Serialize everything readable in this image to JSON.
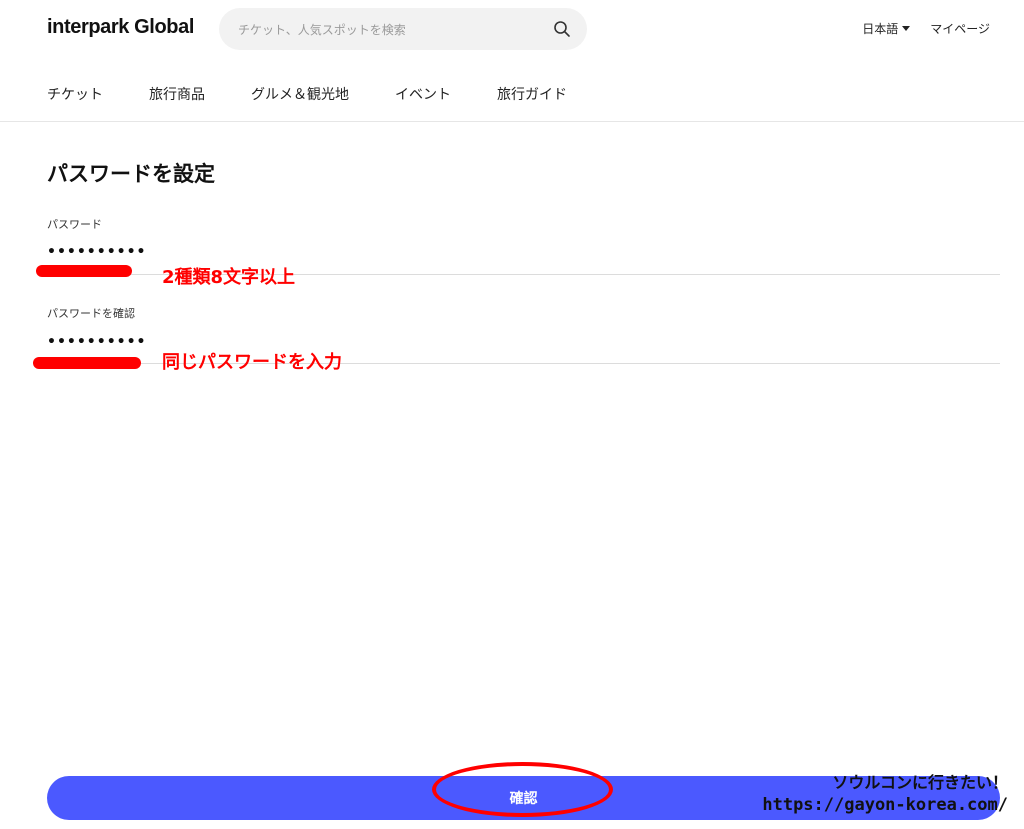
{
  "header": {
    "logo": "interpark Global",
    "search": {
      "placeholder": "チケット、人気スポットを検索",
      "icon": "search-icon"
    },
    "language": "日本語",
    "mypage": "マイページ"
  },
  "nav": {
    "items": [
      {
        "label": "チケット"
      },
      {
        "label": "旅行商品"
      },
      {
        "label": "グルメ＆観光地"
      },
      {
        "label": "イベント"
      },
      {
        "label": "旅行ガイド"
      }
    ]
  },
  "form": {
    "title": "パスワードを設定",
    "password": {
      "label": "パスワード",
      "value": "••••••••••"
    },
    "confirm": {
      "label": "パスワードを確認",
      "value": "••••••••••"
    },
    "submit_label": "確認"
  },
  "annotations": {
    "password_note": "2種類8文字以上",
    "confirm_note": "同じパスワードを入力",
    "color": "#ff0000"
  },
  "watermark": {
    "line1": "ソウルコンに行きたい！",
    "line2": "https://gayon-korea.com/"
  },
  "colors": {
    "accent": "#4b59ff",
    "search_bg": "#f2f2f2",
    "divider": "#e6e6e6"
  }
}
